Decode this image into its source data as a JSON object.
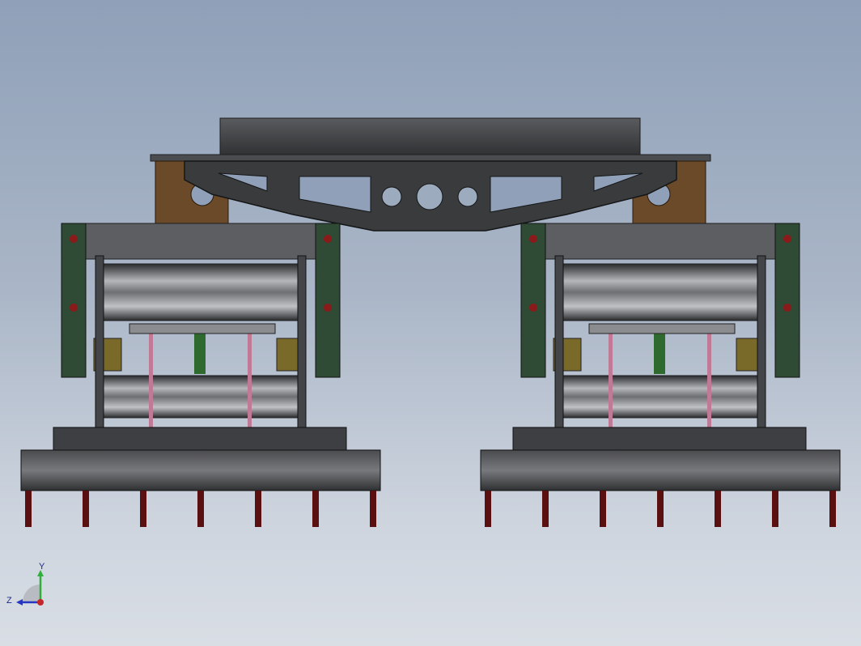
{
  "viewport": {
    "background_top": "#8fa0b8",
    "background_bottom": "#d9dee5"
  },
  "model": {
    "description_icon": "cad-assembly-icon",
    "colors": {
      "frame_dark": "#3a3b3d",
      "frame_mid": "#5c5e61",
      "rail_light": "#9a9c9f",
      "bracket_brown": "#6b4a2a",
      "bearing_green": "#2f4a35",
      "accent_red": "#8b1a1a",
      "shaft_green": "#2e6a2e",
      "pink_rod": "#c07a95",
      "bearing_olive": "#7a6a2a"
    }
  },
  "triad": {
    "y_label": "Y",
    "z_label": "Z",
    "y_color": "#2fae3a",
    "z_color": "#2636c4",
    "x_color": "#c4262a"
  }
}
